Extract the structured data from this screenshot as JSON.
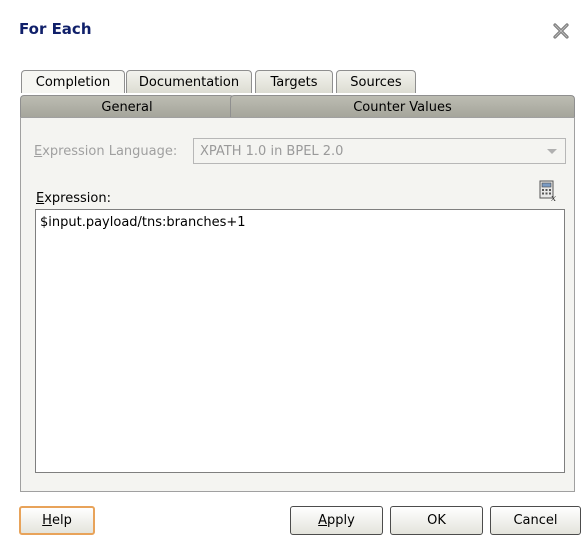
{
  "dialog": {
    "title": "For Each",
    "close_icon": "close-x-icon"
  },
  "tabs_row1": [
    {
      "label": "Completion",
      "active": true
    },
    {
      "label": "Documentation",
      "active": false
    },
    {
      "label": "Targets",
      "active": false
    },
    {
      "label": "Sources",
      "active": false
    }
  ],
  "tabs_row2": [
    {
      "label": "General"
    },
    {
      "label": "Counter Values"
    }
  ],
  "form": {
    "expr_language_label_first": "E",
    "expr_language_label_rest": "xpression Language:",
    "expr_language_value": "XPATH 1.0 in BPEL 2.0",
    "expression_label_first": "E",
    "expression_label_rest": "xpression:",
    "expression_value": "$input.payload/tns:branches+1",
    "builder_icon": "expression-builder-icon"
  },
  "buttons": {
    "help_first": "H",
    "help_rest": "elp",
    "apply_first": "A",
    "apply_rest": "pply",
    "ok": "OK",
    "cancel": "Cancel"
  }
}
